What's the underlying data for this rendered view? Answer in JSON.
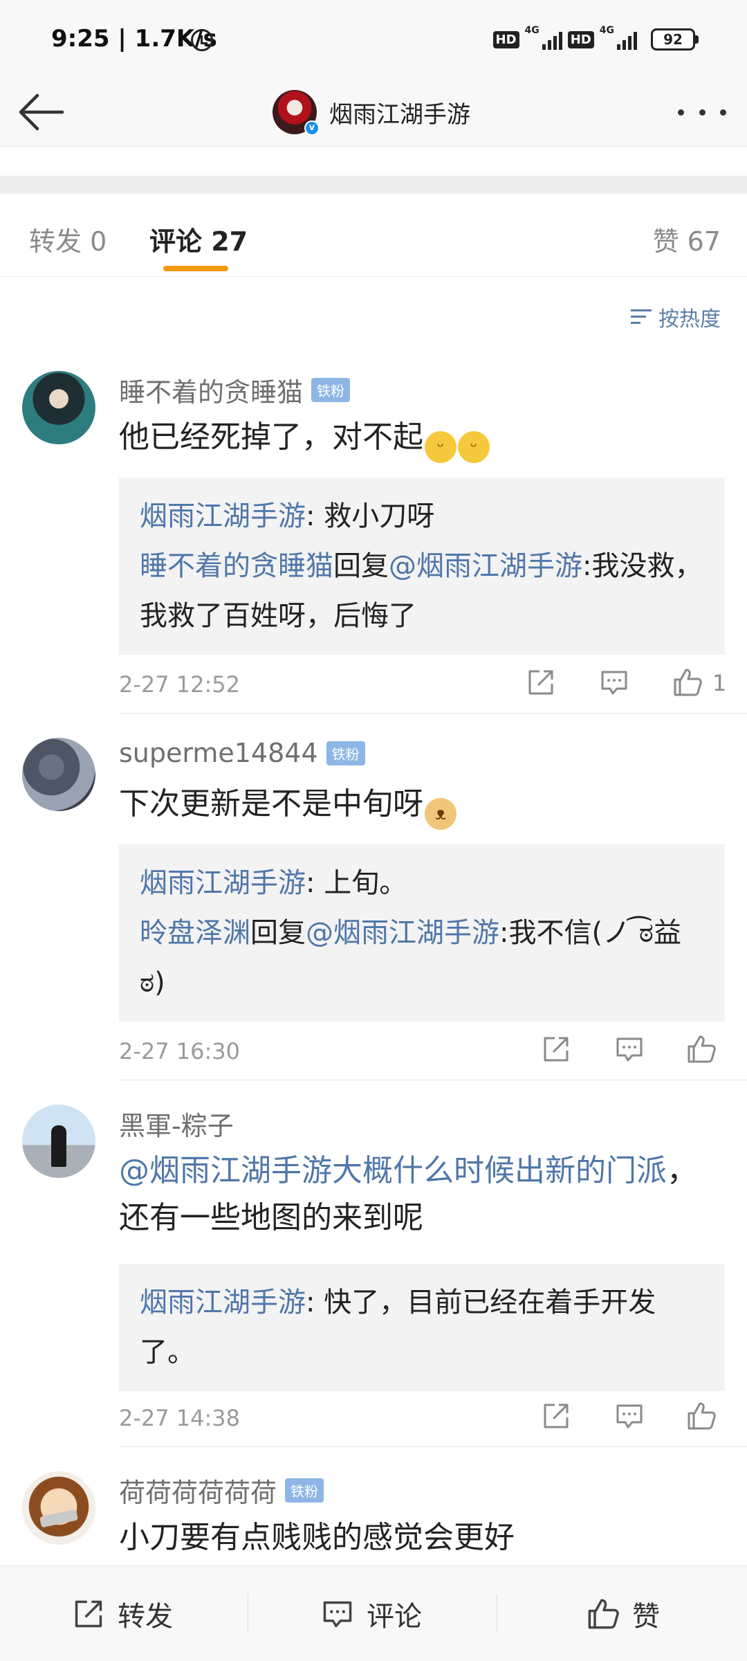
{
  "status_bar": {
    "time_speed": "9:25 | 1.7K/s",
    "hd": "HD",
    "network": "4G",
    "battery": "92"
  },
  "header": {
    "title": "烟雨江湖手游",
    "verified_mark": "v"
  },
  "tabs": {
    "repost": "转发 0",
    "comments": "评论 27",
    "likes": "赞 67"
  },
  "sort_label": "按热度",
  "comments": [
    {
      "user": "睡不着的贪睡猫",
      "badge": "铁粉",
      "text": "他已经死掉了，对不起",
      "reply1_name": "烟雨江湖手游",
      "reply1_text": ": 救小刀呀",
      "reply2_name": "睡不着的贪睡猫",
      "reply2_mid": "回复",
      "reply2_mention": "@烟雨江湖手游",
      "reply2_text": ":我没救，我救了百姓呀，后悔了",
      "time": "2-27 12:52",
      "likes": "1"
    },
    {
      "user": "superme14844",
      "badge": "铁粉",
      "text": "下次更新是不是中旬呀",
      "reply1_name": "烟雨江湖手游",
      "reply1_text": ": 上旬。",
      "reply2_name": "昤盘泽渊",
      "reply2_mid": "回复",
      "reply2_mention": "@烟雨江湖手游",
      "reply2_text": ":我不信(ノ ͡ಠ益ಠ)",
      "time": "2-27 16:30"
    },
    {
      "user": "黑軍-粽子",
      "text_mention": "@烟雨江湖手游大概什么时候出新的门派",
      "text": "，还有一些地图的来到呢",
      "reply1_name": "烟雨江湖手游",
      "reply1_text": ": 快了，目前已经在着手开发了。",
      "time": "2-27 14:38"
    },
    {
      "user": "荷荷荷荷荷荷",
      "badge": "铁粉",
      "text": "小刀要有点贱贱的感觉会更好"
    }
  ],
  "bottom_bar": {
    "repost": "转发",
    "comment": "评论",
    "like": "赞"
  },
  "icons": [
    "back-arrow-icon",
    "more-icon",
    "sort-icon",
    "share-icon",
    "comment-icon",
    "like-icon"
  ]
}
